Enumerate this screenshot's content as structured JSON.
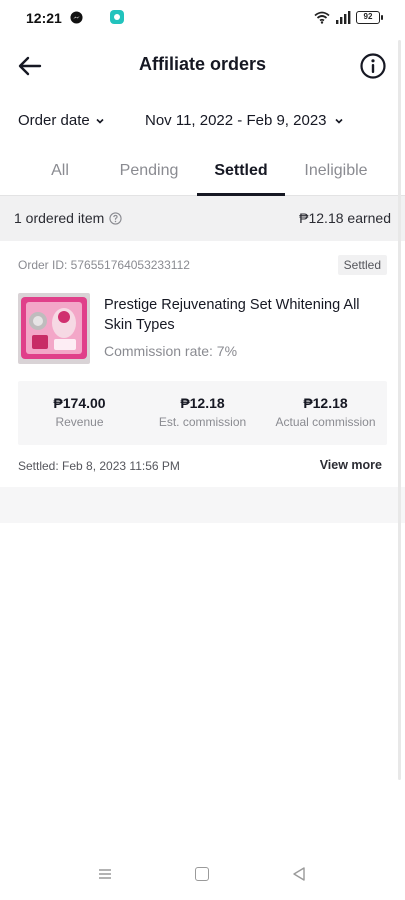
{
  "status_bar": {
    "time": "12:21",
    "battery": "92",
    "icons": [
      "messenger-icon",
      "app-notification-icon",
      "wifi-icon",
      "signal-icon",
      "battery-icon"
    ]
  },
  "header": {
    "title": "Affiliate orders",
    "back_icon": "back-arrow-icon",
    "info_icon": "info-icon"
  },
  "filters": {
    "order_date_label": "Order date",
    "date_range": "Nov 11, 2022 - Feb 9, 2023"
  },
  "tabs": [
    {
      "label": "All",
      "active": false
    },
    {
      "label": "Pending",
      "active": false
    },
    {
      "label": "Settled",
      "active": true
    },
    {
      "label": "Ineligible",
      "active": false
    }
  ],
  "summary": {
    "ordered_count": "1 ordered item",
    "earned": "₱12.18 earned"
  },
  "order": {
    "order_id": "Order ID: 576551764053233112",
    "status": "Settled",
    "product_name": "Prestige Rejuvenating Set Whitening All Skin Types",
    "commission_rate": "Commission rate: 7%",
    "metrics": [
      {
        "value": "₱174.00",
        "label": "Revenue"
      },
      {
        "value": "₱12.18",
        "label": "Est. commission"
      },
      {
        "value": "₱12.18",
        "label": "Actual commission"
      }
    ],
    "settled_time": "Settled: Feb 8, 2023 11:56 PM",
    "view_more": "View more"
  },
  "colors": {
    "text_primary": "#161823",
    "text_secondary": "#8a8b91",
    "panel_bg": "#f1f1f2",
    "product_pink": "#e0408a"
  }
}
